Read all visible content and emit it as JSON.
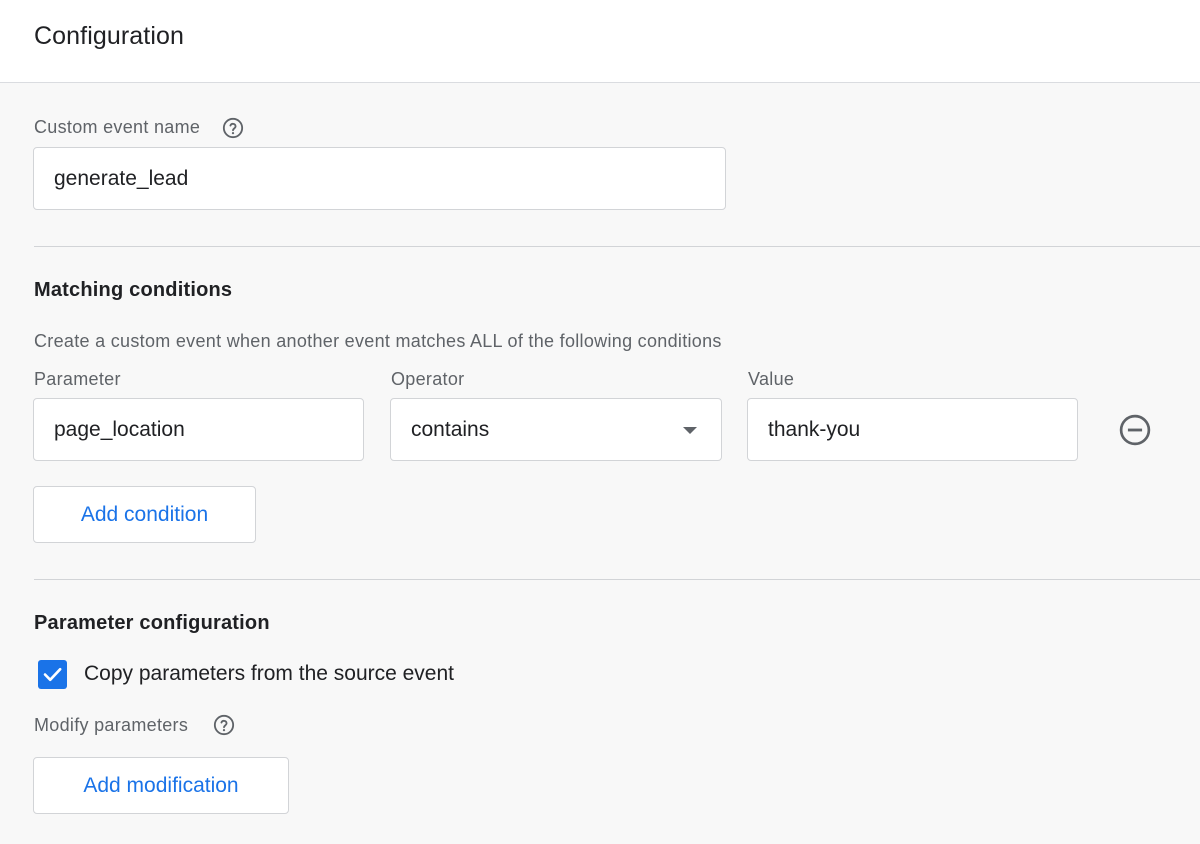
{
  "header": {
    "title": "Configuration"
  },
  "custom_event": {
    "label": "Custom event name",
    "help_icon": "help-circle-icon",
    "value": "generate_lead"
  },
  "matching": {
    "title": "Matching conditions",
    "description": "Create a custom event when another event matches ALL of the following conditions",
    "columns": {
      "parameter": "Parameter",
      "operator": "Operator",
      "value": "Value"
    },
    "condition": {
      "parameter": "page_location",
      "operator": "contains",
      "value": "thank-you",
      "remove_icon": "remove-circle-icon"
    },
    "add_condition_label": "Add condition"
  },
  "param_config": {
    "title": "Parameter configuration",
    "copy_checkbox_label": "Copy parameters from the source event",
    "copy_checked": true,
    "modify_label": "Modify parameters",
    "help_icon": "help-circle-icon",
    "add_modification_label": "Add modification"
  },
  "colors": {
    "accent": "#1a73e8",
    "text": "#202124",
    "secondary_text": "#5f6368",
    "border": "#d2d4d7"
  }
}
